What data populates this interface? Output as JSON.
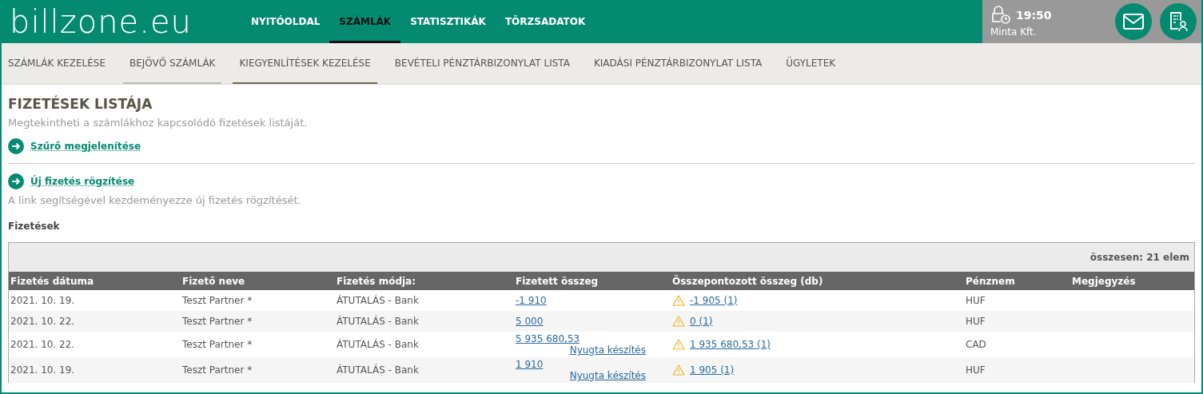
{
  "logo": "billzone.eu",
  "main_nav": [
    {
      "label": "NYITÓOLDAL",
      "selected": false
    },
    {
      "label": "SZÁMLÁK",
      "selected": true
    },
    {
      "label": "STATISZTIKÁK",
      "selected": false
    },
    {
      "label": "TÖRZSADATOK",
      "selected": false
    }
  ],
  "session": {
    "time": "19:50",
    "company": "Minta Kft."
  },
  "sub_nav": [
    {
      "label": "SZÁMLÁK KEZELÉSE",
      "selected": false
    },
    {
      "label": "BEJÖVŐ SZÁMLÁK",
      "selected": false,
      "underlined": true
    },
    {
      "label": "KIEGYENLÍTÉSEK KEZELÉSE",
      "selected": true
    },
    {
      "label": "BEVÉTELI PÉNZTÁRBIZONYLAT LISTA",
      "selected": false
    },
    {
      "label": "KIADÁSI PÉNZTÁRBIZONYLAT LISTA",
      "selected": false
    },
    {
      "label": "ÜGYLETEK",
      "selected": false
    }
  ],
  "page": {
    "title": "FIZETÉSEK LISTÁJA",
    "subtitle": "Megtekintheti a számlákhoz kapcsolódó fizetések listáját.",
    "filter_link": "Szűrő megjelenítése",
    "new_link": "Új fizetés rögzítése",
    "new_hint": "A link segítségével kezdeményezze új fizetés rögzítését.",
    "section": "Fizetések"
  },
  "table": {
    "total": "összesen: 21 elem",
    "columns": [
      "Fizetés dátuma",
      "Fizető neve",
      "Fizetés módja:",
      "Fizetett összeg",
      "Összepontozott összeg (db)",
      "Pénznem",
      "Megjegyzés"
    ],
    "rows": [
      {
        "date": "2021. 10. 19.",
        "payer": "Teszt Partner *",
        "method": "ÁTUTALÁS - Bank",
        "amount": "-1 910",
        "matched": "-1 905 (1)",
        "currency": "HUF"
      },
      {
        "date": "2021. 10. 22.",
        "payer": "Teszt Partner *",
        "method": "ÁTUTALÁS - Bank",
        "amount": "5 000",
        "matched": "0 (1)",
        "currency": "HUF"
      },
      {
        "date": "2021. 10. 22.",
        "payer": "Teszt Partner *",
        "method": "ÁTUTALÁS - Bank",
        "amount": "5 935 680,53",
        "receipt": "Nyugta készítés",
        "matched": "1 935 680,53 (1)",
        "currency": "CAD"
      },
      {
        "date": "2021. 10. 19.",
        "payer": "Teszt Partner *",
        "method": "ÁTUTALÁS - Bank",
        "amount": "1 910",
        "receipt": "Nyugta készítés",
        "matched": "1 905 (1)",
        "currency": "HUF"
      }
    ]
  }
}
